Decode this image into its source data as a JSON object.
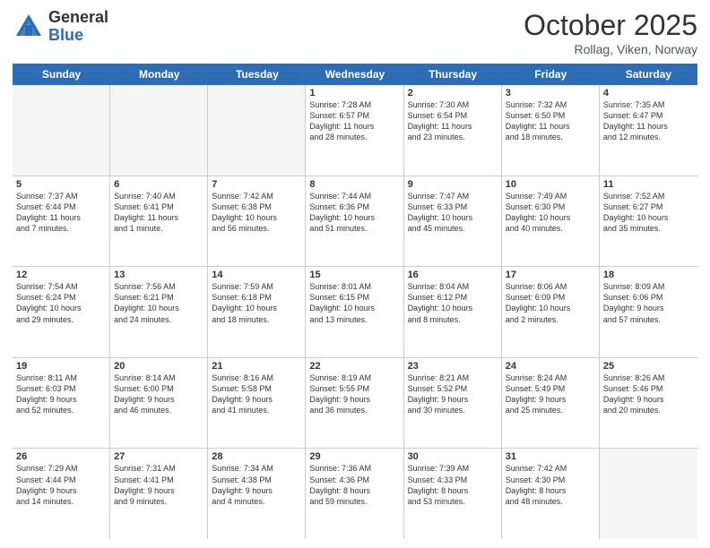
{
  "header": {
    "logo_general": "General",
    "logo_blue": "Blue",
    "month_title": "October 2025",
    "location": "Rollag, Viken, Norway"
  },
  "weekdays": [
    "Sunday",
    "Monday",
    "Tuesday",
    "Wednesday",
    "Thursday",
    "Friday",
    "Saturday"
  ],
  "rows": [
    [
      {
        "day": "",
        "info": "",
        "empty": true
      },
      {
        "day": "",
        "info": "",
        "empty": true
      },
      {
        "day": "",
        "info": "",
        "empty": true
      },
      {
        "day": "1",
        "info": "Sunrise: 7:28 AM\nSunset: 6:57 PM\nDaylight: 11 hours\nand 28 minutes.",
        "empty": false
      },
      {
        "day": "2",
        "info": "Sunrise: 7:30 AM\nSunset: 6:54 PM\nDaylight: 11 hours\nand 23 minutes.",
        "empty": false
      },
      {
        "day": "3",
        "info": "Sunrise: 7:32 AM\nSunset: 6:50 PM\nDaylight: 11 hours\nand 18 minutes.",
        "empty": false
      },
      {
        "day": "4",
        "info": "Sunrise: 7:35 AM\nSunset: 6:47 PM\nDaylight: 11 hours\nand 12 minutes.",
        "empty": false
      }
    ],
    [
      {
        "day": "5",
        "info": "Sunrise: 7:37 AM\nSunset: 6:44 PM\nDaylight: 11 hours\nand 7 minutes.",
        "empty": false
      },
      {
        "day": "6",
        "info": "Sunrise: 7:40 AM\nSunset: 6:41 PM\nDaylight: 11 hours\nand 1 minute.",
        "empty": false
      },
      {
        "day": "7",
        "info": "Sunrise: 7:42 AM\nSunset: 6:38 PM\nDaylight: 10 hours\nand 56 minutes.",
        "empty": false
      },
      {
        "day": "8",
        "info": "Sunrise: 7:44 AM\nSunset: 6:36 PM\nDaylight: 10 hours\nand 51 minutes.",
        "empty": false
      },
      {
        "day": "9",
        "info": "Sunrise: 7:47 AM\nSunset: 6:33 PM\nDaylight: 10 hours\nand 45 minutes.",
        "empty": false
      },
      {
        "day": "10",
        "info": "Sunrise: 7:49 AM\nSunset: 6:30 PM\nDaylight: 10 hours\nand 40 minutes.",
        "empty": false
      },
      {
        "day": "11",
        "info": "Sunrise: 7:52 AM\nSunset: 6:27 PM\nDaylight: 10 hours\nand 35 minutes.",
        "empty": false
      }
    ],
    [
      {
        "day": "12",
        "info": "Sunrise: 7:54 AM\nSunset: 6:24 PM\nDaylight: 10 hours\nand 29 minutes.",
        "empty": false
      },
      {
        "day": "13",
        "info": "Sunrise: 7:56 AM\nSunset: 6:21 PM\nDaylight: 10 hours\nand 24 minutes.",
        "empty": false
      },
      {
        "day": "14",
        "info": "Sunrise: 7:59 AM\nSunset: 6:18 PM\nDaylight: 10 hours\nand 18 minutes.",
        "empty": false
      },
      {
        "day": "15",
        "info": "Sunrise: 8:01 AM\nSunset: 6:15 PM\nDaylight: 10 hours\nand 13 minutes.",
        "empty": false
      },
      {
        "day": "16",
        "info": "Sunrise: 8:04 AM\nSunset: 6:12 PM\nDaylight: 10 hours\nand 8 minutes.",
        "empty": false
      },
      {
        "day": "17",
        "info": "Sunrise: 8:06 AM\nSunset: 6:09 PM\nDaylight: 10 hours\nand 2 minutes.",
        "empty": false
      },
      {
        "day": "18",
        "info": "Sunrise: 8:09 AM\nSunset: 6:06 PM\nDaylight: 9 hours\nand 57 minutes.",
        "empty": false
      }
    ],
    [
      {
        "day": "19",
        "info": "Sunrise: 8:11 AM\nSunset: 6:03 PM\nDaylight: 9 hours\nand 52 minutes.",
        "empty": false
      },
      {
        "day": "20",
        "info": "Sunrise: 8:14 AM\nSunset: 6:00 PM\nDaylight: 9 hours\nand 46 minutes.",
        "empty": false
      },
      {
        "day": "21",
        "info": "Sunrise: 8:16 AM\nSunset: 5:58 PM\nDaylight: 9 hours\nand 41 minutes.",
        "empty": false
      },
      {
        "day": "22",
        "info": "Sunrise: 8:19 AM\nSunset: 5:55 PM\nDaylight: 9 hours\nand 36 minutes.",
        "empty": false
      },
      {
        "day": "23",
        "info": "Sunrise: 8:21 AM\nSunset: 5:52 PM\nDaylight: 9 hours\nand 30 minutes.",
        "empty": false
      },
      {
        "day": "24",
        "info": "Sunrise: 8:24 AM\nSunset: 5:49 PM\nDaylight: 9 hours\nand 25 minutes.",
        "empty": false
      },
      {
        "day": "25",
        "info": "Sunrise: 8:26 AM\nSunset: 5:46 PM\nDaylight: 9 hours\nand 20 minutes.",
        "empty": false
      }
    ],
    [
      {
        "day": "26",
        "info": "Sunrise: 7:29 AM\nSunset: 4:44 PM\nDaylight: 9 hours\nand 14 minutes.",
        "empty": false
      },
      {
        "day": "27",
        "info": "Sunrise: 7:31 AM\nSunset: 4:41 PM\nDaylight: 9 hours\nand 9 minutes.",
        "empty": false
      },
      {
        "day": "28",
        "info": "Sunrise: 7:34 AM\nSunset: 4:38 PM\nDaylight: 9 hours\nand 4 minutes.",
        "empty": false
      },
      {
        "day": "29",
        "info": "Sunrise: 7:36 AM\nSunset: 4:36 PM\nDaylight: 8 hours\nand 59 minutes.",
        "empty": false
      },
      {
        "day": "30",
        "info": "Sunrise: 7:39 AM\nSunset: 4:33 PM\nDaylight: 8 hours\nand 53 minutes.",
        "empty": false
      },
      {
        "day": "31",
        "info": "Sunrise: 7:42 AM\nSunset: 4:30 PM\nDaylight: 8 hours\nand 48 minutes.",
        "empty": false
      },
      {
        "day": "",
        "info": "",
        "empty": true
      }
    ]
  ]
}
